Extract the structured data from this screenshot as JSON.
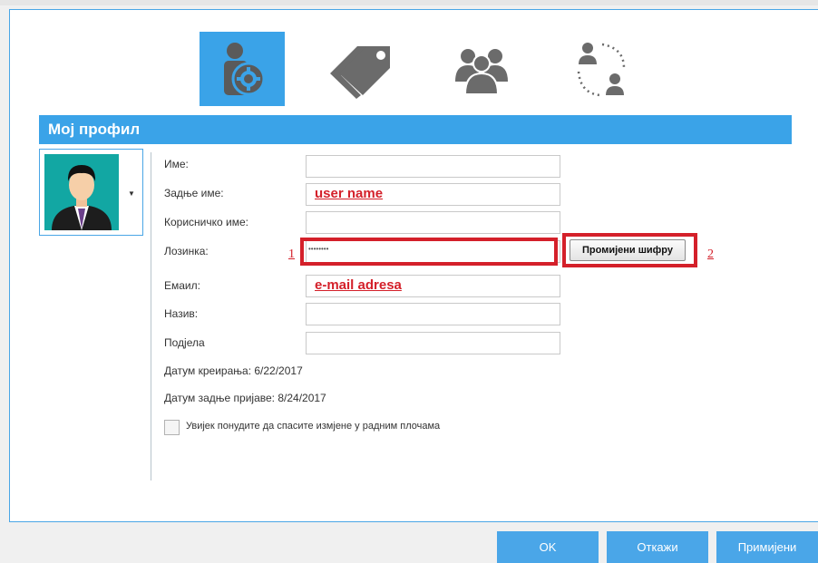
{
  "toolbar": {
    "tabs": [
      {
        "icon": "user-settings-icon",
        "active": true
      },
      {
        "icon": "tags-icon",
        "active": false
      },
      {
        "icon": "group-icon",
        "active": false
      },
      {
        "icon": "user-switch-icon",
        "active": false
      }
    ]
  },
  "section_title": "Мој профил",
  "form": {
    "first_name_label": "Име:",
    "last_name_label": "Задње име:",
    "last_name_value": "user name",
    "username_label": "Корисничко име:",
    "password_label": "Лозинка:",
    "password_value": "••••••••",
    "change_password_label": "Промијени шифру",
    "email_label": "Емаил:",
    "email_value": "e-mail adresa",
    "title_label": "Назив:",
    "department_label": "Подјела",
    "created_text": "Датум креирања: 6/22/2017",
    "last_login_text": "Датум задње пријаве: 8/24/2017",
    "always_offer_save_label": "Увијек понудите да спасите измјене у радним плочама"
  },
  "annotations": {
    "marker_1": "1",
    "marker_2": "2"
  },
  "buttons": {
    "ok": "OK",
    "cancel": "Откажи",
    "apply": "Примијени"
  },
  "colors": {
    "accent": "#3aa3e8",
    "highlight": "#d4202a",
    "icon_gray": "#6b6b6b"
  }
}
